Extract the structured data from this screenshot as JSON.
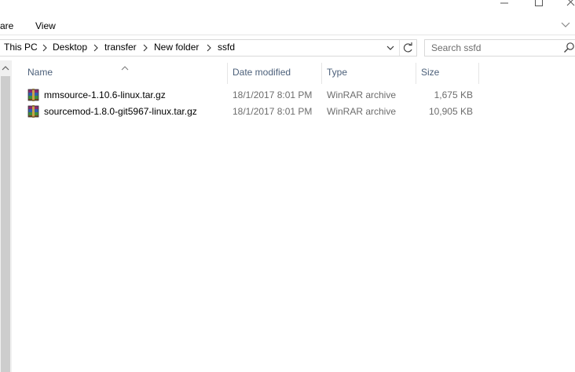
{
  "ribbon": {
    "tabs": [
      {
        "label": "are"
      },
      {
        "label": "View"
      }
    ]
  },
  "address_bar": {
    "breadcrumbs": [
      "This PC",
      "Desktop",
      "transfer",
      "New folder",
      "ssfd"
    ]
  },
  "search": {
    "placeholder": "Search ssfd"
  },
  "columns": {
    "name": "Name",
    "date_modified": "Date modified",
    "type": "Type",
    "size": "Size"
  },
  "files": [
    {
      "name": "mmsource-1.10.6-linux.tar.gz",
      "date_modified": "18/1/2017 8:01 PM",
      "type": "WinRAR archive",
      "size": "1,675 KB",
      "icon": "winrar-archive-icon"
    },
    {
      "name": "sourcemod-1.8.0-git5967-linux.tar.gz",
      "date_modified": "18/1/2017 8:01 PM",
      "type": "WinRAR archive",
      "size": "10,905 KB",
      "icon": "winrar-archive-icon"
    }
  ],
  "colors": {
    "header_text": "#4c607a",
    "secondary_text": "#6d6d6d",
    "scrollbar_thumb": "#cdcdcd"
  }
}
